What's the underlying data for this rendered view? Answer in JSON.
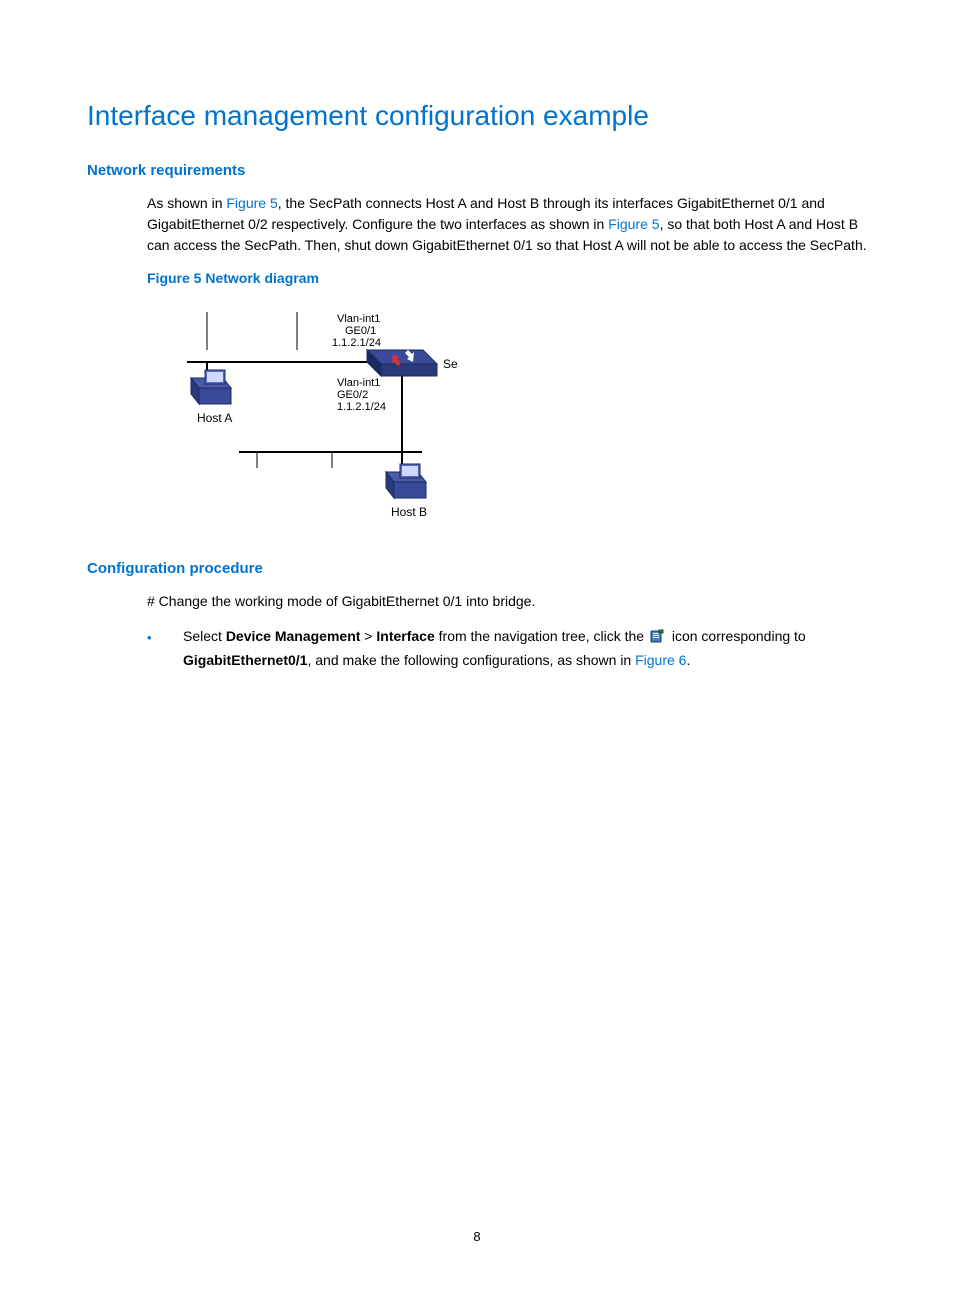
{
  "title": "Interface management configuration example",
  "section_network": {
    "heading": "Network requirements",
    "para_1a": "As shown in ",
    "fig_ref_1": "Figure 5",
    "para_1b": ", the SecPath connects Host A and Host B through its interfaces GigabitEthernet 0/1 and GigabitEthernet 0/2 respectively. Configure the two interfaces as shown in ",
    "fig_ref_2": "Figure 5",
    "para_1c": ", so that both Host A and Host B can access the SecPath. Then, shut down GigabitEthernet 0/1 so that Host A will not be able to access the SecPath."
  },
  "figure": {
    "caption": "Figure 5 Network diagram",
    "labels": {
      "vlan1": "Vlan-int1",
      "ge01": "GE0/1",
      "ip01": "1.1.2.1/24",
      "secpath": "SecPath",
      "vlan2": "Vlan-int1",
      "ge02": "GE0/2",
      "ip02": "1.1.2.1/24",
      "hosta": "Host A",
      "hostb": "Host B"
    }
  },
  "section_config": {
    "heading": "Configuration procedure",
    "step1_text": "# Change the working mode of GigabitEthernet 0/1 into bridge.",
    "bullet": {
      "a": "Select ",
      "b": "Device Management",
      "c": " > ",
      "d": "Interface",
      "e": " from the navigation tree, click the ",
      "f": " icon corresponding to ",
      "g": "GigabitEthernet0/1",
      "h": ", and make the following configurations, as shown in ",
      "fig_ref": "Figure 6",
      "i": "."
    }
  },
  "page_number": "8"
}
